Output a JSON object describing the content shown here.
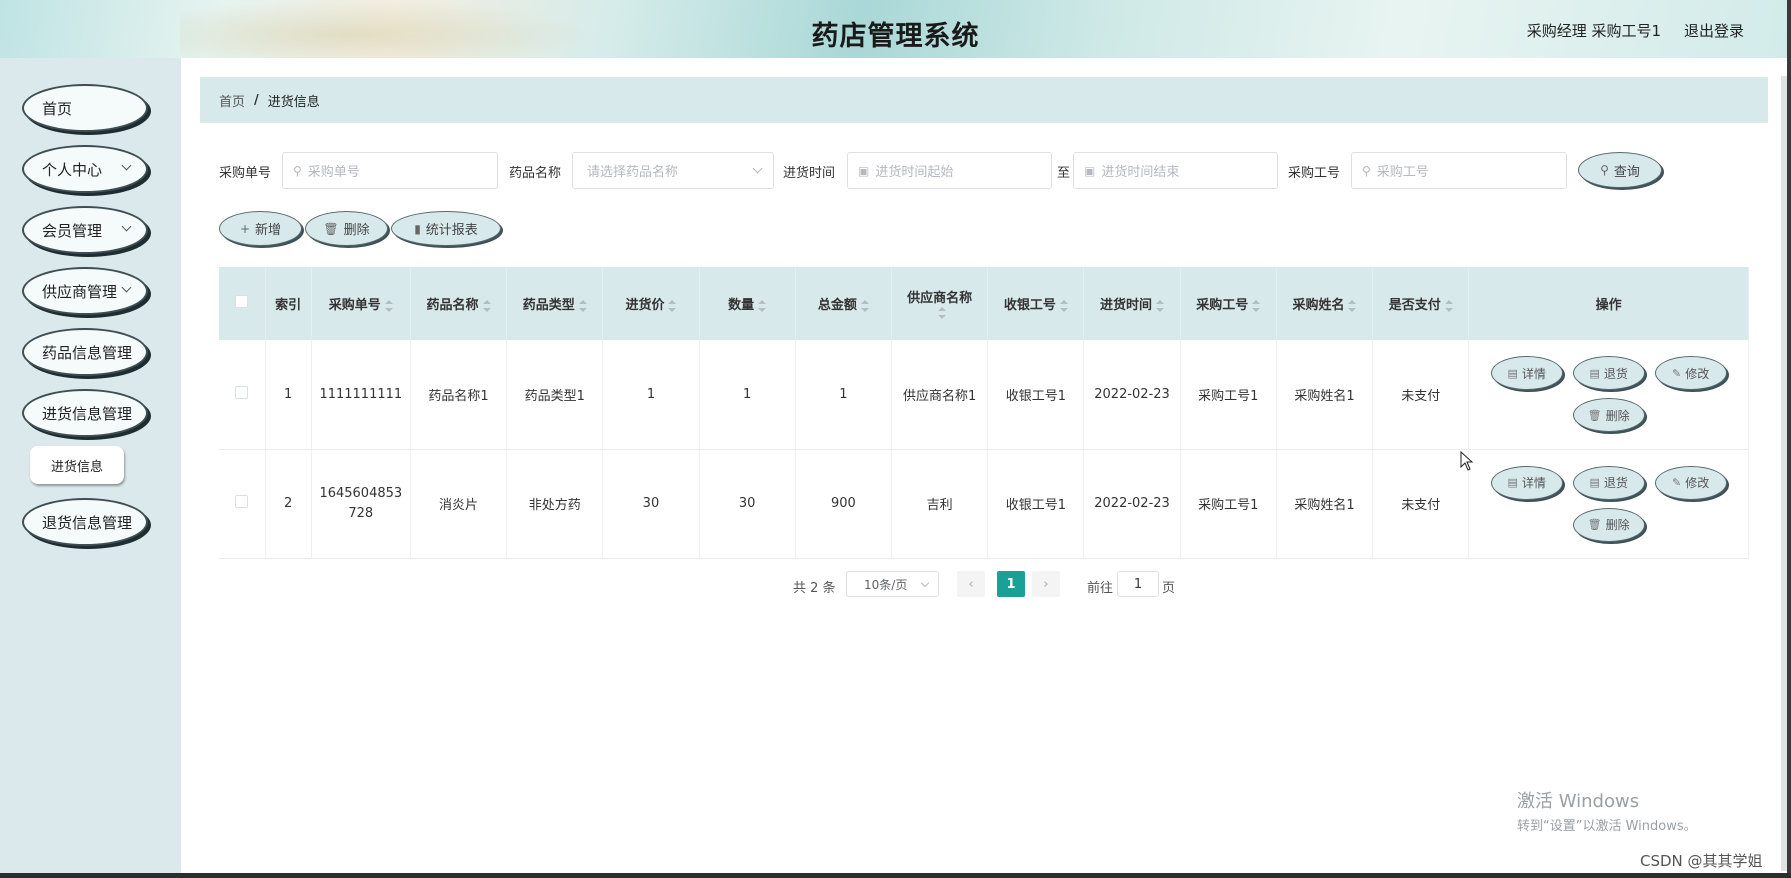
{
  "header": {
    "title": "药店管理系统",
    "user": "采购经理 采购工号1",
    "logout": "退出登录"
  },
  "sidebar": {
    "items": [
      {
        "label": "首页",
        "has_sub": false
      },
      {
        "label": "个人中心",
        "has_sub": true
      },
      {
        "label": "会员管理",
        "has_sub": true
      },
      {
        "label": "供应商管理",
        "has_sub": true
      },
      {
        "label": "药品信息管理",
        "has_sub": false
      },
      {
        "label": "进货信息管理",
        "has_sub": false
      },
      {
        "label": "退货信息管理",
        "has_sub": false
      }
    ],
    "sub_item": "进货信息"
  },
  "breadcrumb": {
    "home": "首页",
    "separator": "/",
    "current": "进货信息"
  },
  "search": {
    "order_label": "采购单号",
    "order_placeholder": "采购单号",
    "drug_label": "药品名称",
    "drug_placeholder": "请选择药品名称",
    "time_label": "进货时间",
    "time_start_placeholder": "进货时间起始",
    "time_sep": "至",
    "time_end_placeholder": "进货时间结束",
    "staff_label": "采购工号",
    "staff_placeholder": "采购工号",
    "query_button": "查询"
  },
  "toolbar": {
    "add": "新增",
    "delete": "删除",
    "report": "统计报表"
  },
  "table": {
    "headers": [
      "索引",
      "采购单号",
      "药品名称",
      "药品类型",
      "进货价",
      "数量",
      "总金额",
      "供应商名称",
      "收银工号",
      "进货时间",
      "采购工号",
      "采购姓名",
      "是否支付",
      "操作"
    ],
    "rows": [
      {
        "index": "1",
        "order_no": "1111111111",
        "drug_name": "药品名称1",
        "drug_type": "药品类型1",
        "price": "1",
        "quantity": "1",
        "total": "1",
        "supplier": "供应商名称1",
        "cashier_id": "收银工号1",
        "purchase_time": "2022-02-23",
        "buyer_id": "采购工号1",
        "buyer_name": "采购姓名1",
        "paid": "未支付"
      },
      {
        "index": "2",
        "order_no": "1645604853728",
        "drug_name": "消炎片",
        "drug_type": "非处方药",
        "price": "30",
        "quantity": "30",
        "total": "900",
        "supplier": "吉利",
        "cashier_id": "收银工号1",
        "purchase_time": "2022-02-23",
        "buyer_id": "采购工号1",
        "buyer_name": "采购姓名1",
        "paid": "未支付"
      }
    ],
    "actions": {
      "detail": "详情",
      "return": "退货",
      "edit": "修改",
      "delete": "删除"
    }
  },
  "pagination": {
    "total": "共 2 条",
    "page_size": "10条/页",
    "current_page": "1",
    "goto_prefix": "前往",
    "goto_value": "1",
    "goto_suffix": "页"
  },
  "watermark": {
    "line1": "激活 Windows",
    "line2": "转到“设置”以激活 Windows。",
    "csdn": "CSDN @其其学姐"
  },
  "colors": {
    "accent": "#1aa096",
    "sidebar_bg": "#dbe9ec",
    "table_header_bg": "#d8e9ec"
  }
}
